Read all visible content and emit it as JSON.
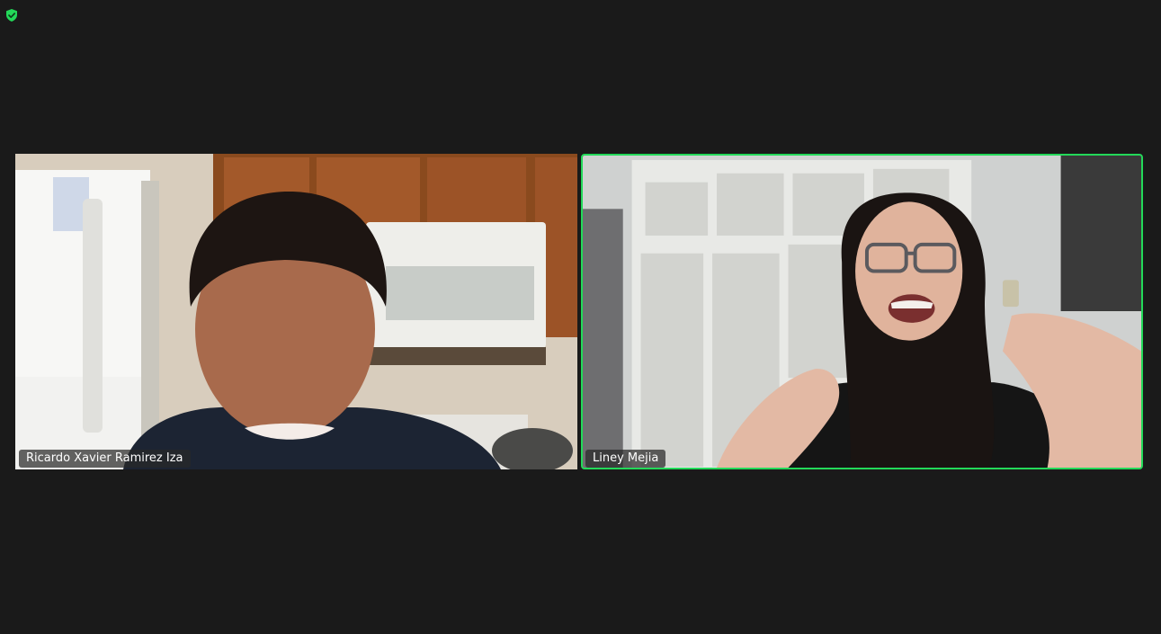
{
  "meeting": {
    "encryption_icon": "shield-check-icon",
    "active_speaker_color": "#23d959",
    "background_color": "#1a1a1a"
  },
  "participants": [
    {
      "name": "Ricardo Xavier Ramirez Iza",
      "active_speaker": false
    },
    {
      "name": "Liney Mejia",
      "active_speaker": true
    }
  ]
}
